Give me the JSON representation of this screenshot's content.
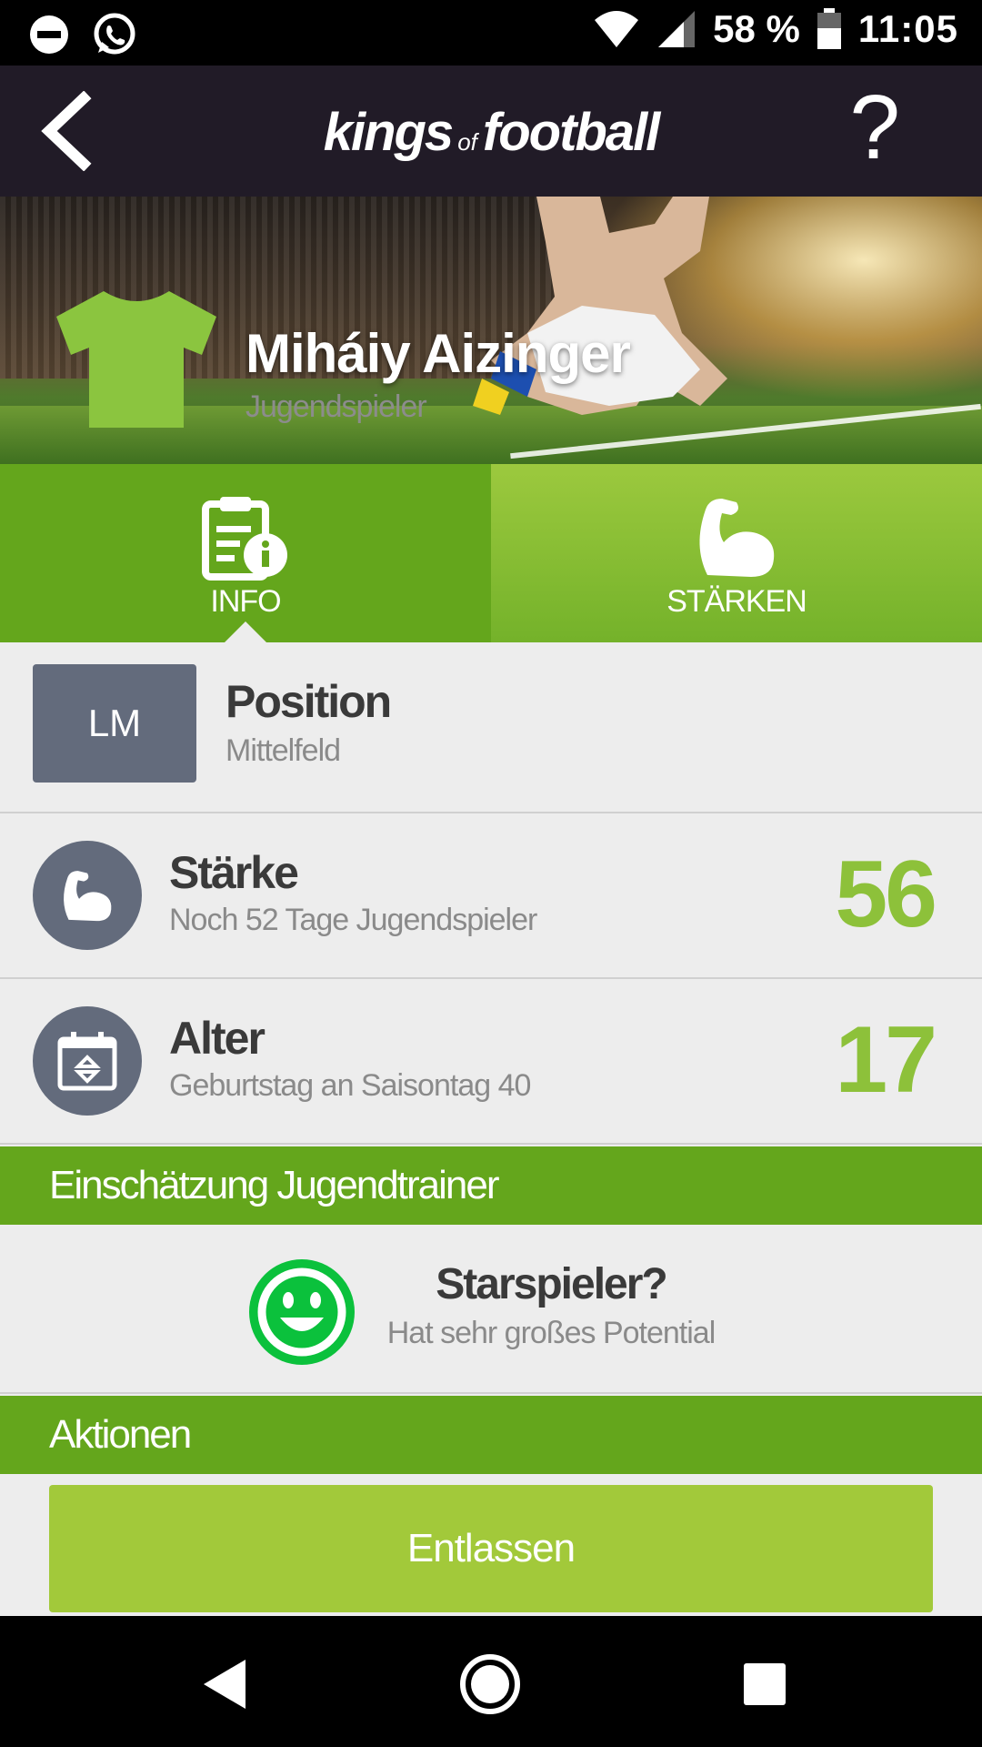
{
  "status_bar": {
    "battery": "58 %",
    "time": "11:05",
    "icons": [
      "do-not-disturb-icon",
      "whatsapp-icon",
      "wifi-icon",
      "signal-icon",
      "battery-icon"
    ]
  },
  "header": {
    "logo_kings": "kings",
    "logo_of": "of",
    "logo_football": "football",
    "help_label": "?",
    "icons": [
      "back-icon"
    ]
  },
  "hero": {
    "player_name": "Miháiy Aizinger",
    "player_role": "Jugendspieler",
    "jersey_color": "#8bc53f"
  },
  "tabs": [
    {
      "label": "INFO",
      "icon": "info-document-icon",
      "active": true
    },
    {
      "label": "STÄRKEN",
      "icon": "flexed-arm-icon",
      "active": false
    }
  ],
  "info": {
    "position": {
      "code": "LM",
      "title": "Position",
      "subtitle": "Mittelfeld"
    },
    "strength": {
      "title": "Stärke",
      "subtitle": "Noch 52 Tage Jugendspieler",
      "value": "56",
      "icon": "flexed-arm-icon"
    },
    "age": {
      "title": "Alter",
      "subtitle": "Geburtstag an Saisontag 40",
      "value": "17",
      "icon": "calendar-icon"
    }
  },
  "coach": {
    "section_title": "Einschätzung Jugendtrainer",
    "title": "Starspieler?",
    "subtitle": "Hat sehr großes Potential",
    "icon": "smiley-icon"
  },
  "actions": {
    "section_title": "Aktionen",
    "dismiss_label": "Entlassen"
  },
  "colors": {
    "header_bg": "#211b27",
    "green_dark": "#64a61c",
    "green_light": "#8dc13a",
    "button_green": "#a2c93a",
    "slate": "#636b7c",
    "smiley_green": "#0bc13c"
  },
  "nav_bar": {
    "icons": [
      "nav-back-icon",
      "nav-home-icon",
      "nav-recent-icon"
    ]
  }
}
